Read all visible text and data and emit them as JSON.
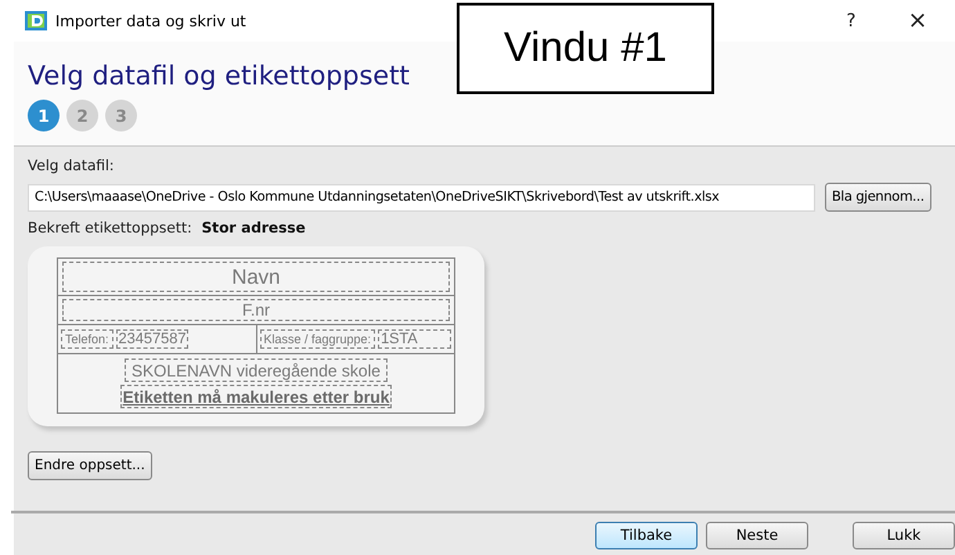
{
  "window": {
    "title": "Importer data og skriv ut",
    "controls": [
      "?",
      "×"
    ]
  },
  "annotation": "Vindu #1",
  "heading": "Velg datafil og etikettoppsett",
  "steps": [
    {
      "label": "1",
      "selected": true
    },
    {
      "label": "2",
      "selected": false
    },
    {
      "label": "3",
      "selected": false
    }
  ],
  "file": {
    "label": "Velg datafil:",
    "value": "C:\\Users\\maaase\\OneDrive - Oslo Kommune Utdanningsetaten\\OneDriveSIKT\\Skrivebord\\Test av utskrift.xlsx",
    "browse": "Bla gjennom..."
  },
  "layout": {
    "label": "Bekreft etikettoppsett:",
    "value": "Stor adresse"
  },
  "label_preview": {
    "name": "Navn",
    "id": "F.nr",
    "phone_label": "Telefon:",
    "phone": "23457587",
    "class_label": "Klasse / faggruppe:",
    "class": "1STA",
    "school": "SKOLENAVN videregående skole",
    "notice": "Etiketten må makuleres etter bruk"
  },
  "change_button": "Endre oppsett...",
  "buttons": [
    {
      "label": "Tilbake",
      "selected": true
    },
    {
      "label": "Neste",
      "selected": false
    },
    {
      "label": "Lukk",
      "selected": false
    }
  ]
}
